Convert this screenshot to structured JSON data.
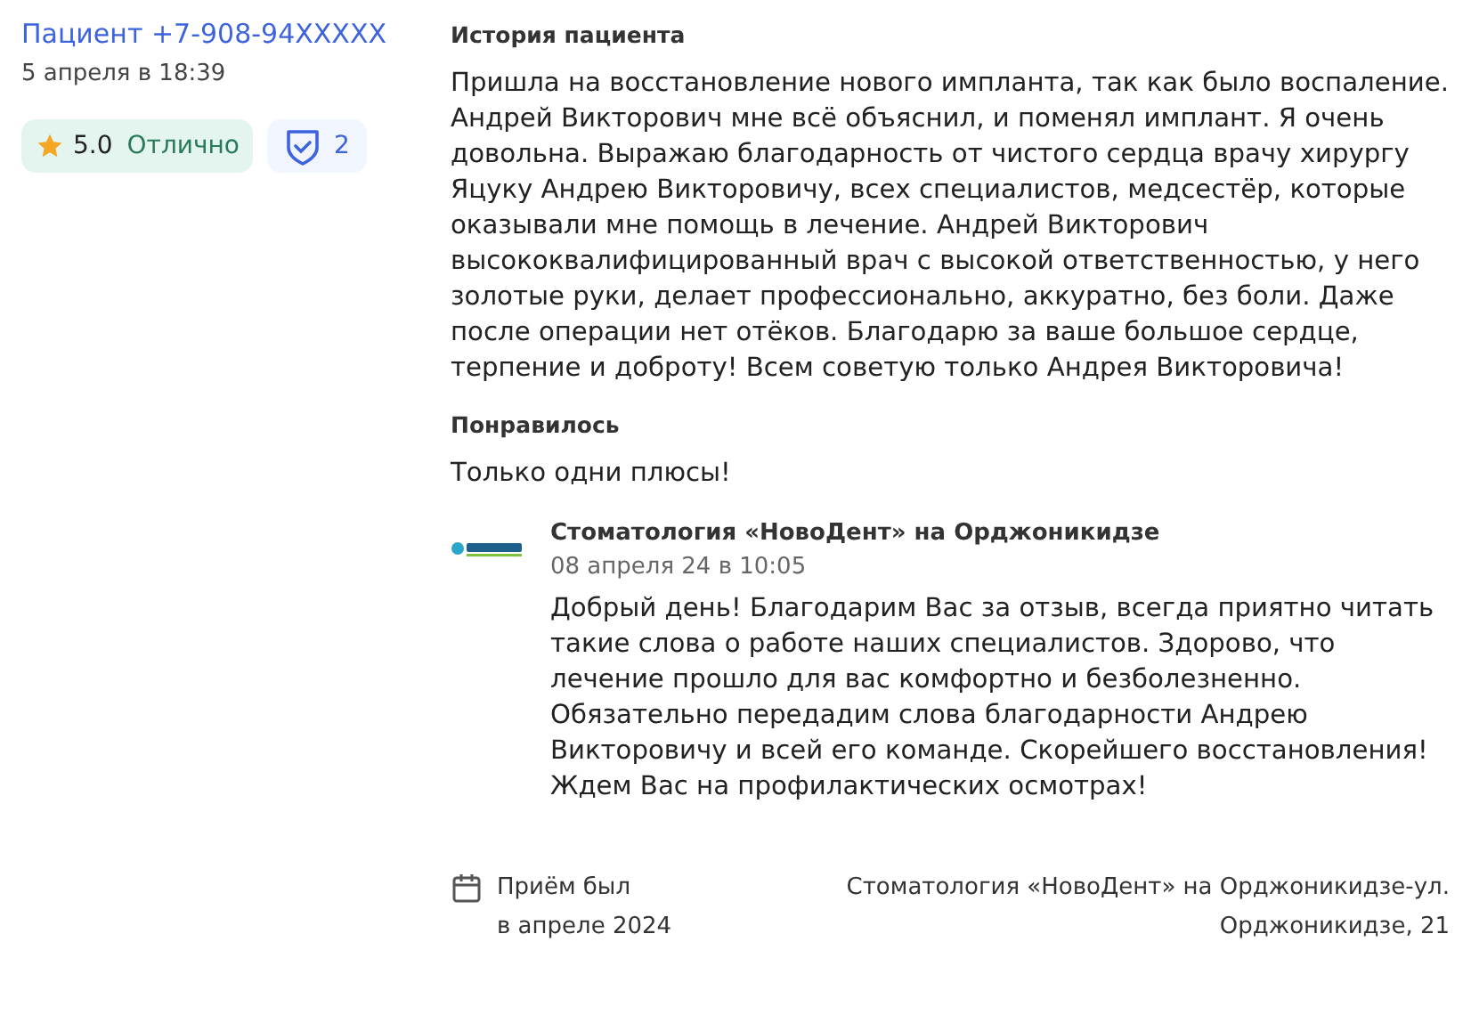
{
  "author": {
    "name": "Пациент +7-908-94XXXXX",
    "date": "5 апреля в 18:39"
  },
  "rating": {
    "score": "5.0",
    "label": "Отлично"
  },
  "verified": {
    "count": "2"
  },
  "story": {
    "title": "История пациента",
    "text": "Пришла на восстановление нового импланта, так как было воспаление. Андрей Викторович мне всё объяснил, и поменял имплант. Я очень довольна. Выражаю благодарность от чистого сердца врачу хирургу Яцуку Андрею Викторовичу, всех специалистов, медсестёр, которые оказывали мне помощь в лечение. Андрей Викторович высококвалифицированный врач с высокой ответственностью, у него золотые руки, делает профессионально, аккуратно, без боли. Даже после операции нет отёков. Благодарю за ваше большое сердце, терпение и доброту! Всем советую только Андрея Викторовича!"
  },
  "liked": {
    "title": "Понравилось",
    "text": "Только одни плюсы!"
  },
  "reply": {
    "clinic": "Стоматология «НовоДент» на Орджоникидзе",
    "date": "08 апреля 24 в 10:05",
    "text": "Добрый день! Благодарим Вас за отзыв, всегда приятно читать такие слова о работе наших специалистов. Здорово, что лечение прошло для вас комфортно и безболезненно. Обязательно передадим слова благодарности Андрею Викторовичу и всей его команде. Скорейшего восстановления! Ждем Вас на профилактических осмотрах!"
  },
  "visit": {
    "line_1": "Приём был",
    "line_2": "в апреле 2024"
  },
  "location": {
    "line_1": "Стоматология «НовоДент» на Орджоникидзе-ул.",
    "line_2": "Орджоникидзе, 21"
  }
}
